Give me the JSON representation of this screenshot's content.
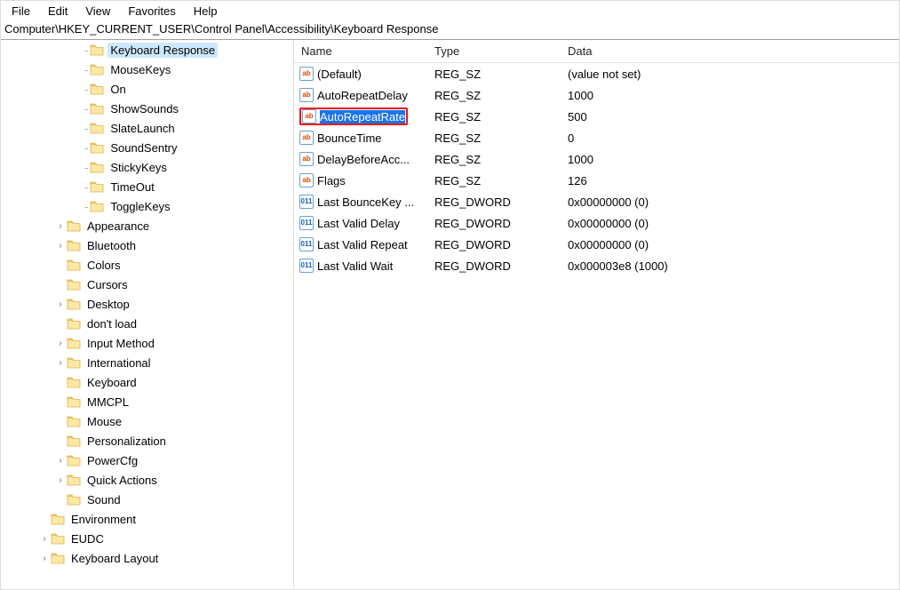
{
  "menu": {
    "file": "File",
    "edit": "Edit",
    "view": "View",
    "favorites": "Favorites",
    "help": "Help"
  },
  "address": "Computer\\HKEY_CURRENT_USER\\Control Panel\\Accessibility\\Keyboard Response",
  "columns": {
    "name": "Name",
    "type": "Type",
    "data": "Data"
  },
  "tree": {
    "kb_children": [
      {
        "label": "Keyboard Response",
        "indent": 3,
        "selected": true
      },
      {
        "label": "MouseKeys",
        "indent": 3
      },
      {
        "label": "On",
        "indent": 3
      },
      {
        "label": "ShowSounds",
        "indent": 3
      },
      {
        "label": "SlateLaunch",
        "indent": 3
      },
      {
        "label": "SoundSentry",
        "indent": 3
      },
      {
        "label": "StickyKeys",
        "indent": 3
      },
      {
        "label": "TimeOut",
        "indent": 3
      },
      {
        "label": "ToggleKeys",
        "indent": 3
      }
    ],
    "cp_children": [
      {
        "label": "Appearance",
        "indent": 2,
        "exp": ">"
      },
      {
        "label": "Bluetooth",
        "indent": 2,
        "exp": ">"
      },
      {
        "label": "Colors",
        "indent": 2,
        "exp": ""
      },
      {
        "label": "Cursors",
        "indent": 2,
        "exp": ""
      },
      {
        "label": "Desktop",
        "indent": 2,
        "exp": ">"
      },
      {
        "label": "don't load",
        "indent": 2,
        "exp": ""
      },
      {
        "label": "Input Method",
        "indent": 2,
        "exp": ">"
      },
      {
        "label": "International",
        "indent": 2,
        "exp": ">"
      },
      {
        "label": "Keyboard",
        "indent": 2,
        "exp": ""
      },
      {
        "label": "MMCPL",
        "indent": 2,
        "exp": ""
      },
      {
        "label": "Mouse",
        "indent": 2,
        "exp": ""
      },
      {
        "label": "Personalization",
        "indent": 2,
        "exp": ""
      },
      {
        "label": "PowerCfg",
        "indent": 2,
        "exp": ">"
      },
      {
        "label": "Quick Actions",
        "indent": 2,
        "exp": ">"
      },
      {
        "label": "Sound",
        "indent": 2,
        "exp": ""
      }
    ],
    "hkcu_tail": [
      {
        "label": "Environment",
        "indent": 1,
        "exp": ""
      },
      {
        "label": "EUDC",
        "indent": 1,
        "exp": ">"
      },
      {
        "label": "Keyboard Layout",
        "indent": 1,
        "exp": ">"
      }
    ]
  },
  "values": [
    {
      "icon": "sz",
      "name": "(Default)",
      "type": "REG_SZ",
      "data": "(value not set)"
    },
    {
      "icon": "sz",
      "name": "AutoRepeatDelay",
      "type": "REG_SZ",
      "data": "1000"
    },
    {
      "icon": "sz",
      "name": "AutoRepeatRate",
      "type": "REG_SZ",
      "data": "500",
      "highlighted": true
    },
    {
      "icon": "sz",
      "name": "BounceTime",
      "type": "REG_SZ",
      "data": "0"
    },
    {
      "icon": "sz",
      "name": "DelayBeforeAcc...",
      "type": "REG_SZ",
      "data": "1000"
    },
    {
      "icon": "sz",
      "name": "Flags",
      "type": "REG_SZ",
      "data": "126"
    },
    {
      "icon": "dw",
      "name": "Last BounceKey ...",
      "type": "REG_DWORD",
      "data": "0x00000000 (0)"
    },
    {
      "icon": "dw",
      "name": "Last Valid Delay",
      "type": "REG_DWORD",
      "data": "0x00000000 (0)"
    },
    {
      "icon": "dw",
      "name": "Last Valid Repeat",
      "type": "REG_DWORD",
      "data": "0x00000000 (0)"
    },
    {
      "icon": "dw",
      "name": "Last Valid Wait",
      "type": "REG_DWORD",
      "data": "0x000003e8 (1000)"
    }
  ],
  "icon_text": {
    "sz": "ab",
    "dw": "011"
  }
}
